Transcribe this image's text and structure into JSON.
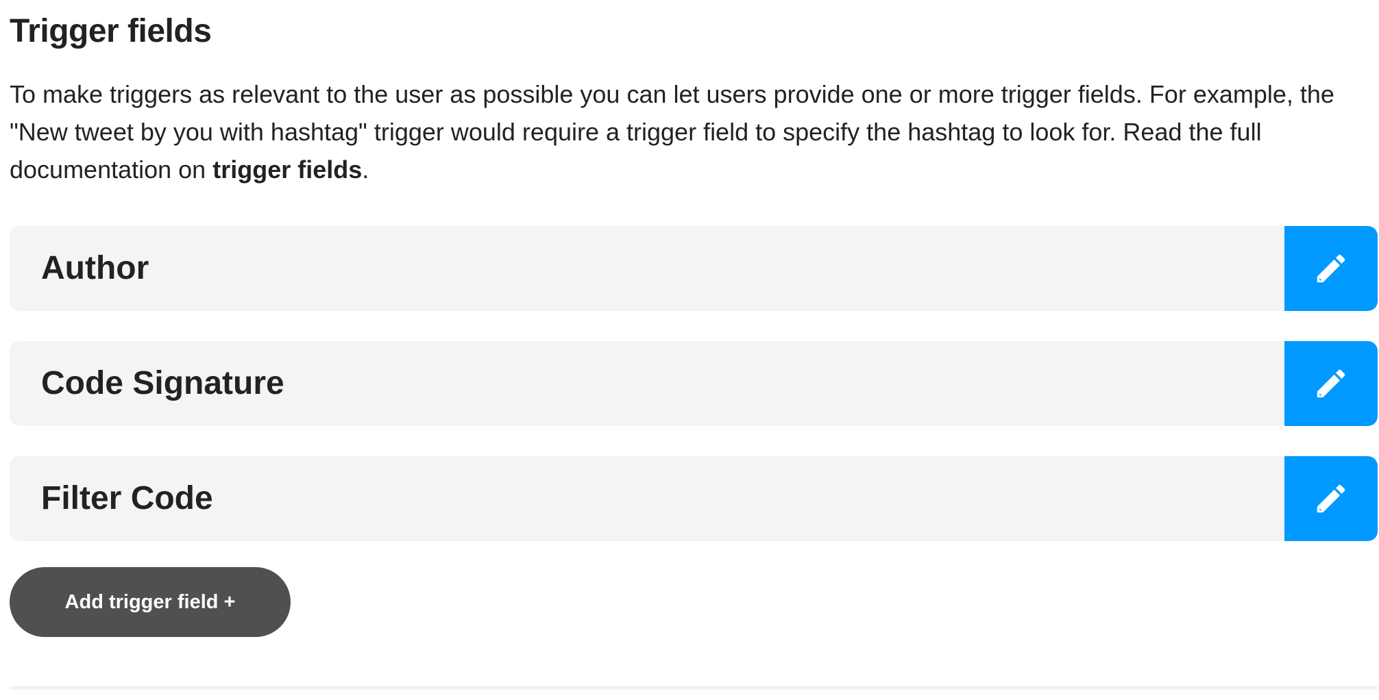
{
  "section": {
    "title": "Trigger fields",
    "description_text": "To make triggers as relevant to the user as possible you can let users provide one or more trigger fields. For example, the \"New tweet by you with hashtag\" trigger would require a trigger field to specify the hashtag to look for. Read the full documentation on ",
    "description_link": "trigger fields",
    "description_end": "."
  },
  "fields": [
    {
      "label": "Author"
    },
    {
      "label": "Code Signature"
    },
    {
      "label": "Filter Code"
    }
  ],
  "icons": {
    "edit": "pencil-icon"
  },
  "add_button": {
    "label": "Add trigger field +"
  },
  "colors": {
    "accent": "#0099ff",
    "row_background": "#f4f4f4",
    "add_button_background": "#505050",
    "text": "#222222"
  }
}
